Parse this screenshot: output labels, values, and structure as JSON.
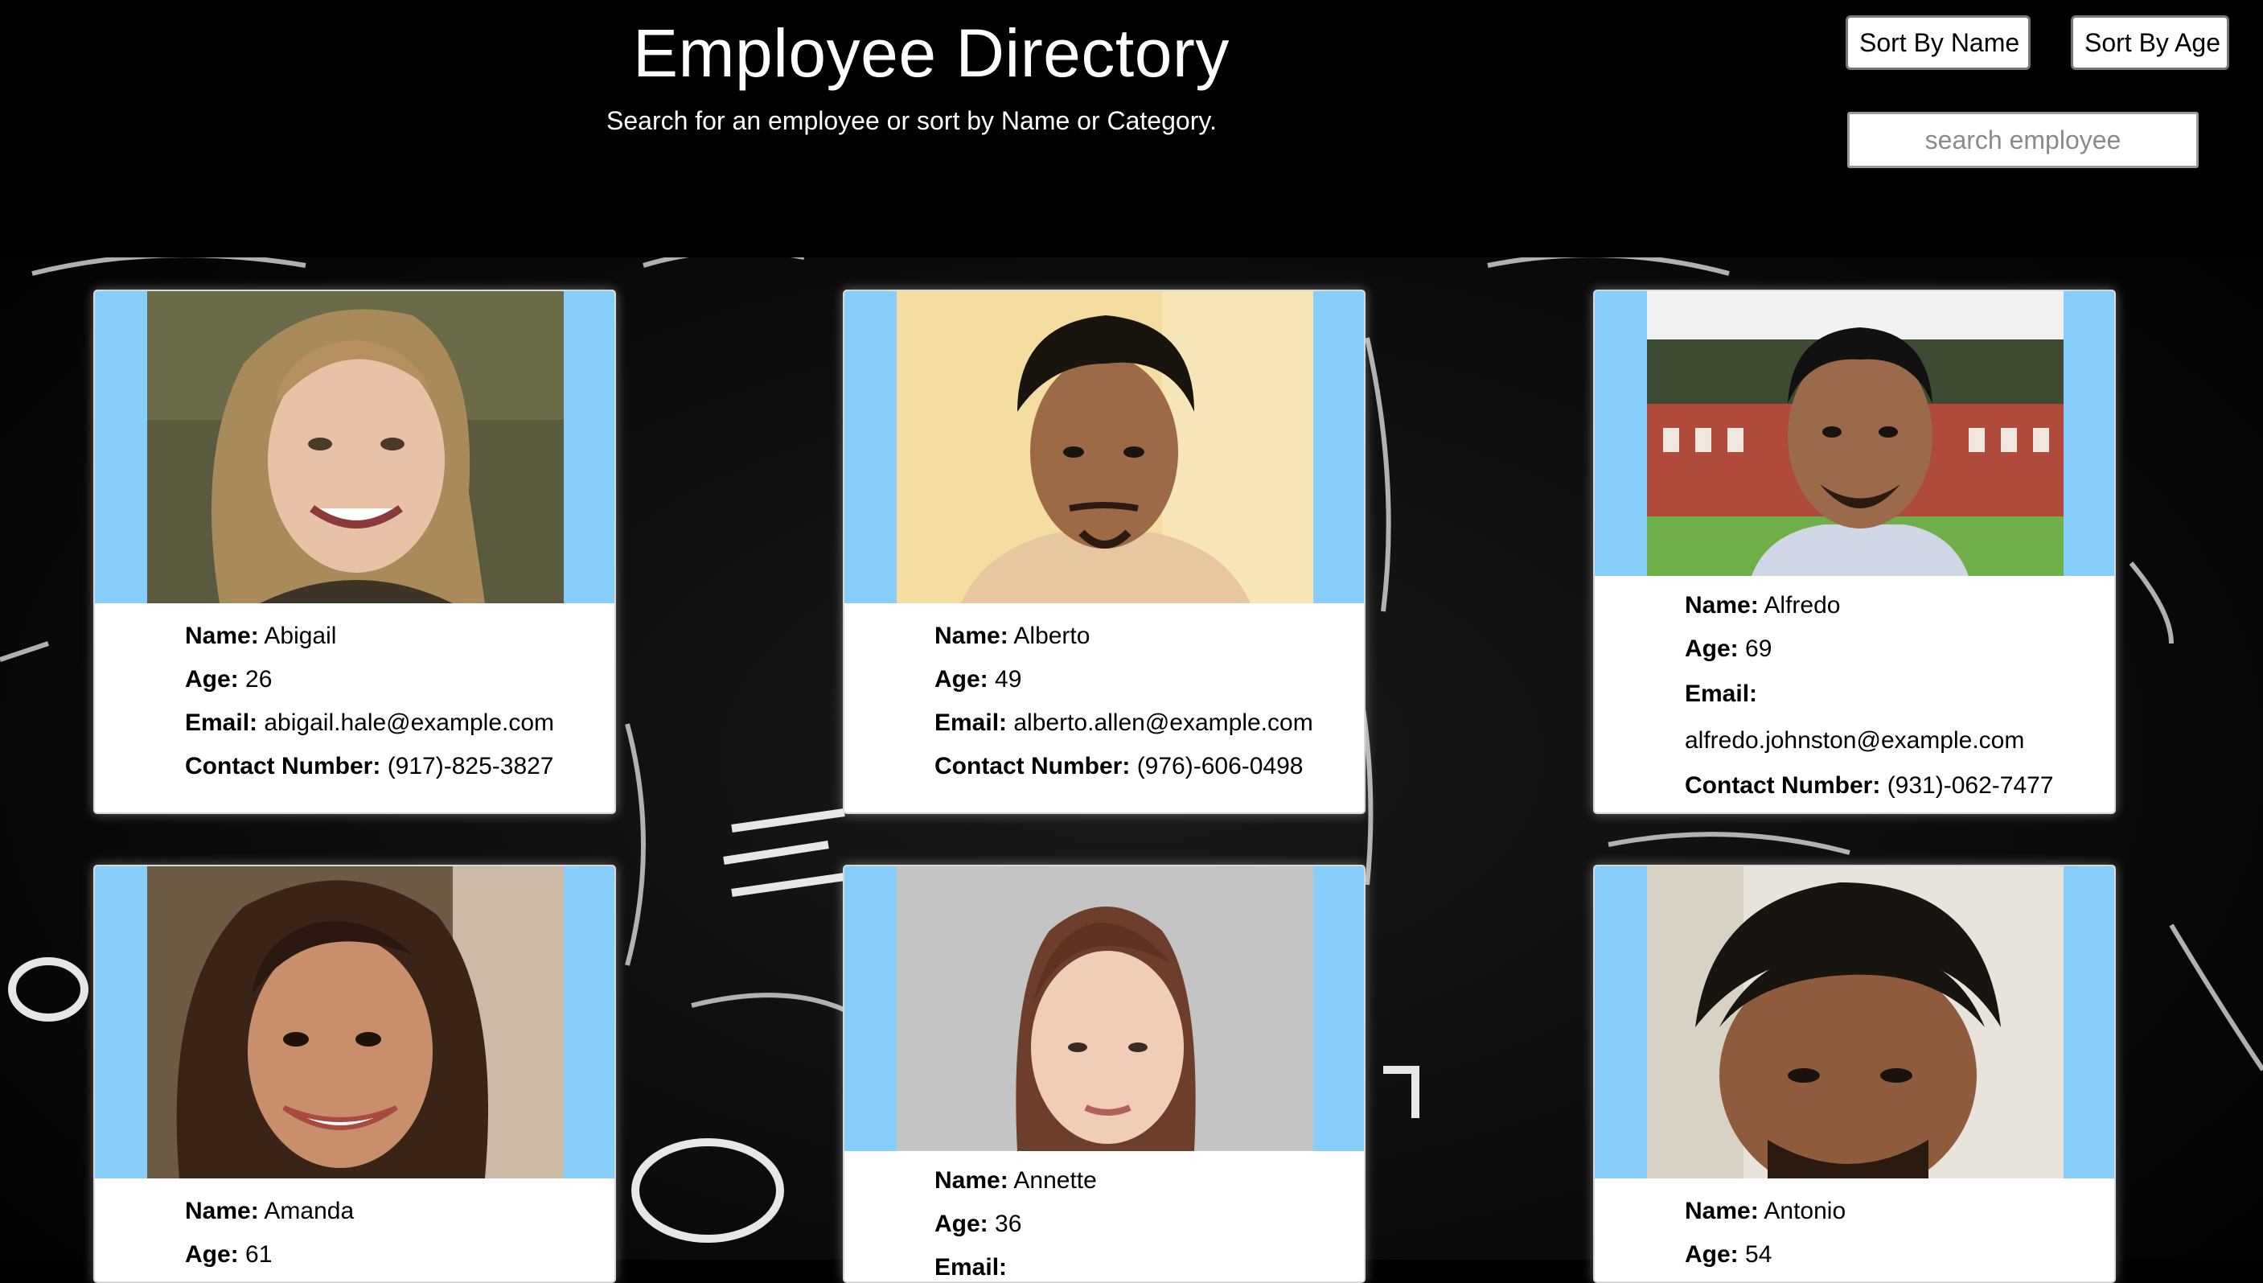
{
  "header": {
    "title": "Employee Directory",
    "subtitle": "Search for an employee or sort by Name or Category.",
    "sort_name_label": "Sort By Name",
    "sort_age_label": "Sort By Age",
    "search_placeholder": "search employee"
  },
  "labels": {
    "name": "Name:",
    "age": "Age:",
    "email": "Email:",
    "contact": "Contact Number:"
  },
  "colors": {
    "card_band": "#87cefa",
    "background": "#000000"
  },
  "employees": [
    {
      "name": "Abigail",
      "age": "26",
      "email": "abigail.hale@example.com",
      "phone": "(917)-825-3827"
    },
    {
      "name": "Alberto",
      "age": "49",
      "email": "alberto.allen@example.com",
      "phone": "(976)-606-0498"
    },
    {
      "name": "Alfredo",
      "age": "69",
      "email": "alfredo.johnston@example.com",
      "phone": "(931)-062-7477"
    },
    {
      "name": "Amanda",
      "age": "61"
    },
    {
      "name": "Annette",
      "age": "36"
    },
    {
      "name": "Antonio",
      "age": "54"
    }
  ]
}
